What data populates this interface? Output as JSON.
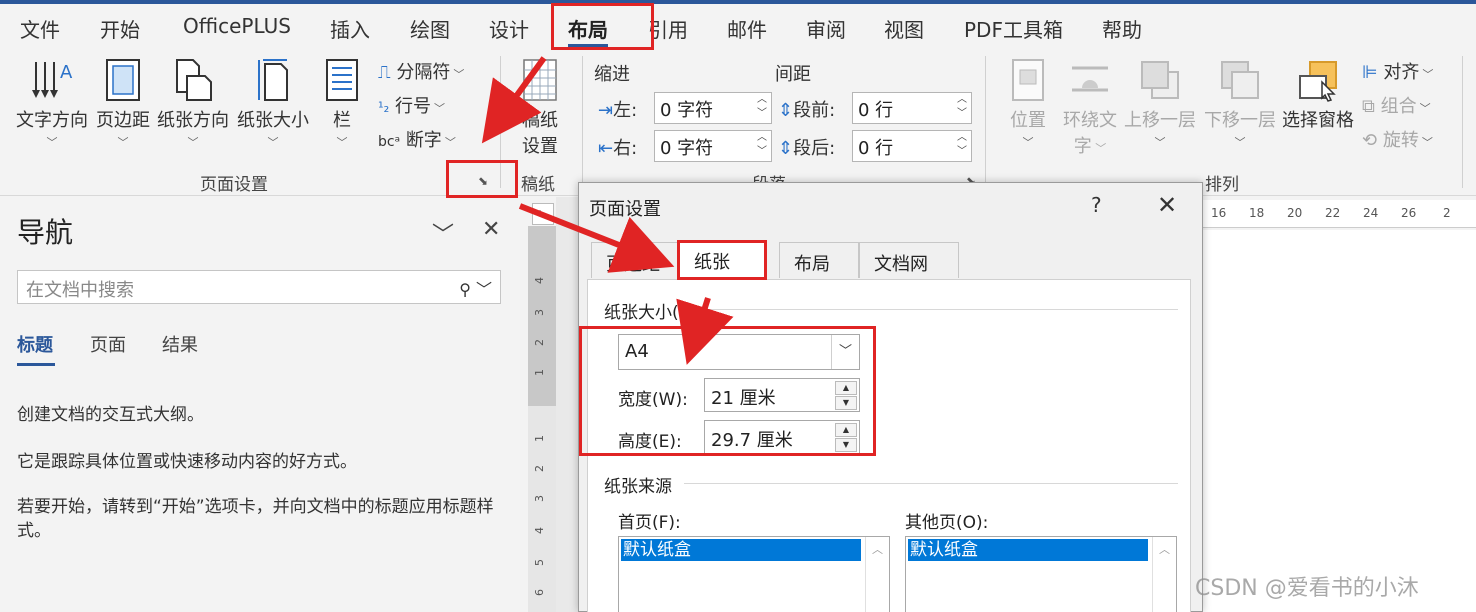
{
  "tabs": [
    "文件",
    "开始",
    "OfficePLUS",
    "插入",
    "绘图",
    "设计",
    "布局",
    "引用",
    "邮件",
    "审阅",
    "视图",
    "PDF工具箱",
    "帮助"
  ],
  "page_setup_group": {
    "text_direction": "文字方向",
    "margins": "页边距",
    "orientation": "纸张方向",
    "size": "纸张大小",
    "columns": "栏",
    "breaks": "分隔符",
    "line_numbers": "行号",
    "hyphenation": "断字",
    "label": "页面设置"
  },
  "draft_group": {
    "button_line1": "稿纸",
    "button_line2": "设置",
    "label": "稿纸"
  },
  "paragraph_group": {
    "indent_title": "缩进",
    "spacing_title": "间距",
    "left_label": "左:",
    "right_label": "右:",
    "left_value": "0 字符",
    "right_value": "0 字符",
    "before_label": "段前:",
    "after_label": "段后:",
    "before_value": "0 行",
    "after_value": "0 行",
    "label": "段落"
  },
  "arrange_group": {
    "position": "位置",
    "wrap_line1": "环绕文",
    "wrap_line2": "字",
    "bring_forward": "上移一层",
    "send_backward": "下移一层",
    "selection_pane": "选择窗格",
    "align": "对齐",
    "group": "组合",
    "rotate": "旋转",
    "label": "排列"
  },
  "nav": {
    "title": "导航",
    "search_placeholder": "在文档中搜索",
    "tabs": [
      "标题",
      "页面",
      "结果"
    ],
    "p1": "创建文档的交互式大纲。",
    "p2": "它是跟踪具体位置或快速移动内容的好方式。",
    "p3": "若要开始，请转到“开始”选项卡，并向文档中的标题应用标题样式。"
  },
  "ruler": {
    "h_ticks": [
      "16",
      "18",
      "20",
      "22",
      "24",
      "26",
      "2"
    ],
    "v_ticks": [
      "4",
      "3",
      "2",
      "1",
      "1",
      "2",
      "3",
      "4",
      "5",
      "6"
    ]
  },
  "dialog": {
    "title": "页面设置",
    "help": "?",
    "close": "✕",
    "tabs": [
      "页边距",
      "纸张",
      "布局",
      "文档网格"
    ],
    "paper_size_label": "纸张大小(R):",
    "paper_size_value": "A4",
    "width_label": "宽度(W):",
    "width_value": "21 厘米",
    "height_label": "高度(E):",
    "height_value": "29.7 厘米",
    "source_label": "纸张来源",
    "first_page_label": "首页(F):",
    "other_pages_label": "其他页(O):",
    "first_page_item": "默认纸盒",
    "other_pages_item": "默认纸盒"
  },
  "watermark": "CSDN @爱看书的小沐",
  "colors": {
    "accent": "#2b579a",
    "annotation_red": "#e02424",
    "selection": "#0078d7"
  }
}
